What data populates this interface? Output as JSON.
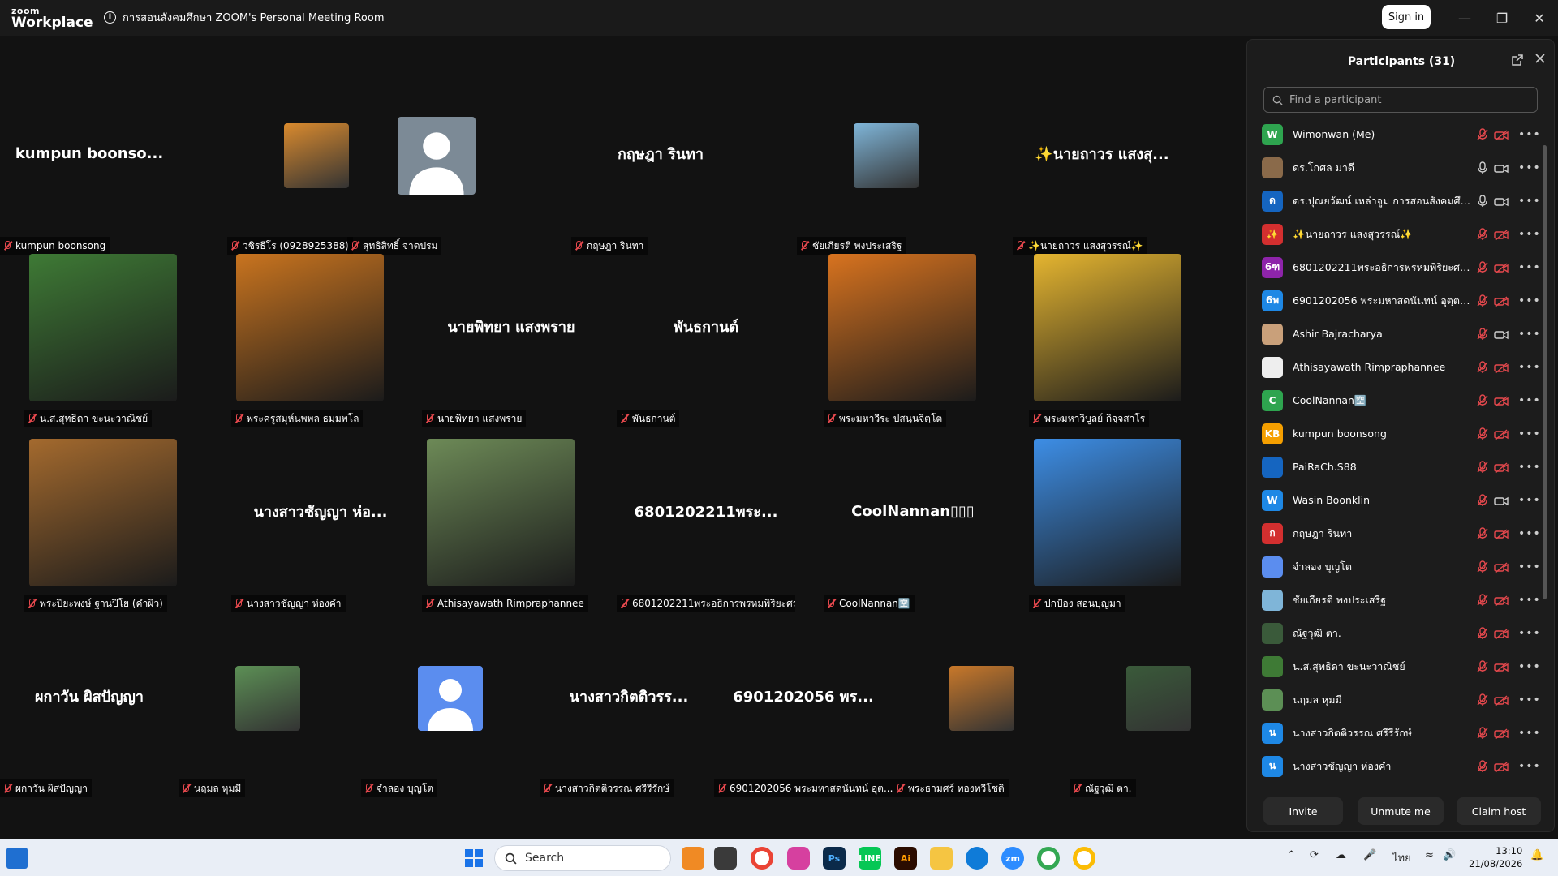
{
  "app": {
    "logo_line1": "zoom",
    "logo_line2": "Workplace",
    "meeting_title": "การสอนสังคมศึกษา ZOOM's Personal Meeting Room",
    "signin_label": "Sign in"
  },
  "gallery": [
    {
      "label": "kumpun boonsong",
      "center": "kumpun  boonso...",
      "kind": "name"
    },
    {
      "label": "วชิรธีโร (0928925388)",
      "center": "",
      "kind": "photo-small",
      "color": "#d98a2e"
    },
    {
      "label": "สุทธิสิทธิ์ จาดปรม",
      "center": "",
      "kind": "avatar-gray"
    },
    {
      "label": "กฤษฎา รินทา",
      "center": "กฤษฎา รินทา",
      "kind": "name"
    },
    {
      "label": "ชัยเกียรติ พงประเสริฐ",
      "center": "",
      "kind": "photo-small",
      "color": "#7fb5d8"
    },
    {
      "label": "✨นายถาวร แสงสุวรรณ์✨",
      "center": "✨นายถาวร แสงสุ...",
      "kind": "name"
    },
    {
      "label": "น.ส.สุทธิดา ขะนะวาณิชย์",
      "center": "",
      "kind": "photo",
      "color": "#3e7a35"
    },
    {
      "label": "พระครูสมุห์นพพล  ธมฺมพโล",
      "center": "",
      "kind": "photo",
      "color": "#c9741f"
    },
    {
      "label": "นายพิทยา แสงพราย",
      "center": "นายพิทยา แสงพราย",
      "kind": "name"
    },
    {
      "label": "พันธกานต์",
      "center": "พันธกานต์",
      "kind": "name"
    },
    {
      "label": "พระมหาวีระ ปสนฺนจิตฺโต",
      "center": "",
      "kind": "photo",
      "color": "#d8731f"
    },
    {
      "label": "พระมหาวิบูลย์ กิจฺจสาโร",
      "center": "",
      "kind": "photo",
      "color": "#e5b530"
    },
    {
      "label": "พระปิยะพงษ์ ฐานปิโย (คำผิว)",
      "center": "",
      "kind": "photo",
      "color": "#a46a2e"
    },
    {
      "label": "นางสาวชัญญา ห่องคำ",
      "center": "นางสาวชัญญา ห่อ...",
      "kind": "name"
    },
    {
      "label": "Athisayawath Rimpraphannee",
      "center": "",
      "kind": "photo",
      "color": "#6d8a57"
    },
    {
      "label": "6801202211พระอธิการพรหมพิริยะศร สุวฑ...",
      "center": "6801202211พระ...",
      "kind": "name"
    },
    {
      "label": "CoolNannan🈳",
      "center": "CoolNannan▯▯▯",
      "kind": "name"
    },
    {
      "label": "ปกป้อง สอนบุญมา",
      "center": "",
      "kind": "photo",
      "color": "#3d8ee6"
    },
    {
      "label": "ผกาวัน ผิสปัญญา",
      "center": "ผกาวัน ผิสปัญญา",
      "kind": "name"
    },
    {
      "label": "นฤมล หุมมี",
      "center": "",
      "kind": "photo-small",
      "color": "#5c8f55"
    },
    {
      "label": "จำลอง บุญโต",
      "center": "",
      "kind": "avatar-blue"
    },
    {
      "label": "นางสาวกิตติวรรณ ศรีรีรักษ์",
      "center": "นางสาวกิตติวรร...",
      "kind": "name"
    },
    {
      "label": "6901202056 พระมหาสดนันทน์ อุต...",
      "center": "6901202056 พร...",
      "kind": "name"
    },
    {
      "label": "พระธามศร์ ทองทวีโชติ",
      "center": "",
      "kind": "photo-small",
      "color": "#c8782a"
    },
    {
      "label": "ณัฐวุฒิ  ตา.",
      "center": "",
      "kind": "photo-small",
      "color": "#3a5a3a"
    }
  ],
  "panel": {
    "title": "Participants (31)",
    "search_placeholder": "Find a participant",
    "participants": [
      {
        "name": "Wimonwan (Me)",
        "initial": "W",
        "color": "#2ea44f",
        "mic": "off",
        "cam": "off"
      },
      {
        "name": "ดร.โกศล มาดี",
        "initial": "",
        "color": "#8a6a4a",
        "mic": "on",
        "cam": "on"
      },
      {
        "name": "ดร.ปุณยวัฒน์ เหล่าจูม การสอนสังคมศึก...",
        "initial": "ด",
        "color": "#1565c0",
        "mic": "on",
        "cam": "on"
      },
      {
        "name": "✨นายถาวร แสงสุวรรณ์✨",
        "initial": "✨",
        "color": "#d32f2f",
        "mic": "off",
        "cam": "off"
      },
      {
        "name": "6801202211พระอธิการพรหมพิริยะศร สุ...",
        "initial": "6ฑ",
        "color": "#8e24aa",
        "mic": "off",
        "cam": "off"
      },
      {
        "name": "6901202056 พระมหาสดนันทน์ อุตฺตมเมธี",
        "initial": "6พ",
        "color": "#1e88e5",
        "mic": "off",
        "cam": "off"
      },
      {
        "name": "Ashir Bajracharya",
        "initial": "",
        "color": "#c9a07a",
        "mic": "off",
        "cam": "on"
      },
      {
        "name": "Athisayawath Rimpraphannee",
        "initial": "",
        "color": "#eeeeee",
        "mic": "off",
        "cam": "off"
      },
      {
        "name": "CoolNannan🈳",
        "initial": "C",
        "color": "#2ea44f",
        "mic": "off",
        "cam": "off"
      },
      {
        "name": "kumpun boonsong",
        "initial": "KB",
        "color": "#f59f00",
        "mic": "off",
        "cam": "off"
      },
      {
        "name": "PaiRaCh.S88",
        "initial": "",
        "color": "#1565c0",
        "mic": "off",
        "cam": "off"
      },
      {
        "name": "Wasin Boonklin",
        "initial": "W",
        "color": "#1e88e5",
        "mic": "off",
        "cam": "on"
      },
      {
        "name": "กฤษฎา รินทา",
        "initial": "ก",
        "color": "#d32f2f",
        "mic": "off",
        "cam": "off"
      },
      {
        "name": "จำลอง บุญโต",
        "initial": "",
        "color": "#5b8def",
        "mic": "off",
        "cam": "off"
      },
      {
        "name": "ชัยเกียรติ พงประเสริฐ",
        "initial": "",
        "color": "#7fb5d8",
        "mic": "off",
        "cam": "off"
      },
      {
        "name": "ณัฐวุฒิ  ตา.",
        "initial": "",
        "color": "#3a5a3a",
        "mic": "off",
        "cam": "off"
      },
      {
        "name": "น.ส.สุทธิดา ขะนะวาณิชย์",
        "initial": "",
        "color": "#3e7a35",
        "mic": "off",
        "cam": "off"
      },
      {
        "name": "นฤมล หุมมี",
        "initial": "",
        "color": "#5c8f55",
        "mic": "off",
        "cam": "off"
      },
      {
        "name": "นางสาวกิตติวรรณ ศรีรีรักษ์",
        "initial": "น",
        "color": "#1e88e5",
        "mic": "off",
        "cam": "off"
      },
      {
        "name": "นางสาวชัญญา ห่องคำ",
        "initial": "น",
        "color": "#1e88e5",
        "mic": "off",
        "cam": "off"
      }
    ],
    "buttons": {
      "invite": "Invite",
      "unmute": "Unmute me",
      "claim": "Claim host"
    }
  },
  "taskbar": {
    "search_label": "Search",
    "lang": "ไทย",
    "time": "13:10",
    "date": "21/08/2026"
  }
}
